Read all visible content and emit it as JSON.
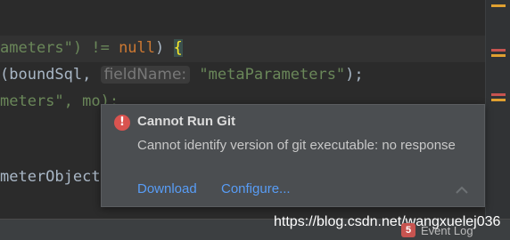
{
  "editor": {
    "lines": [
      {
        "a": "ameters\") != ",
        "kw": "null",
        "b": ") ",
        "brace": "{"
      },
      {
        "a": "(boundSql, ",
        "hint": "fieldName:",
        "str": "\"metaParameters\"",
        "b": ");"
      },
      {
        "a": "meters\", mo);"
      },
      {
        "a": "meterObject"
      }
    ]
  },
  "notification": {
    "icon": "error-icon",
    "icon_glyph": "!",
    "title": "Cannot Run Git",
    "message": "Cannot identify version of git executable: no response",
    "actions": {
      "download": "Download",
      "configure": "Configure..."
    },
    "collapse_icon": "chevron-up-icon"
  },
  "status_bar": {
    "event_log_count": "5",
    "event_log_label": "Event Log"
  },
  "watermark": "https://blog.csdn.net/wangxuelej036",
  "colors": {
    "background": "#2b2b2b",
    "popup": "#4b4e51",
    "link": "#589df6",
    "error": "#d9534f",
    "string": "#6a8759",
    "keyword": "#cc7832"
  }
}
